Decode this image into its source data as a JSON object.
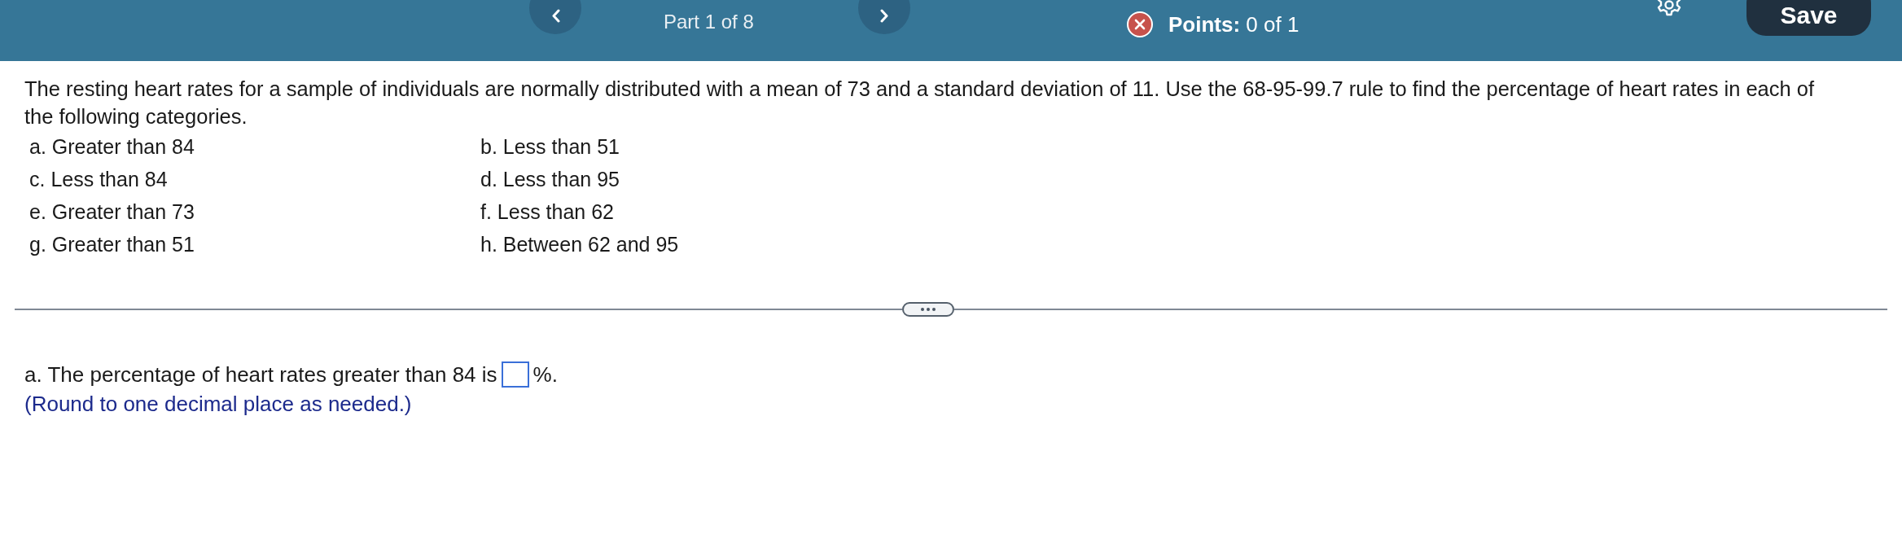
{
  "header": {
    "part": "Part 1 of 8",
    "points": {
      "correct": false,
      "text": "**Points:** 0 of 1"
    },
    "save_button": "Save"
  },
  "question": {
    "text": "The resting heart rates for a sample of individuals are normally distributed with a mean of 73 and a standard deviation of 11. Use the 68-95-99.7 rule to find the percentage of heart rates in each of the following categories.",
    "categories": [
      "a. Greater than 84",
      "b. Less than 51",
      "c. Less than 84",
      "d. Less than 95",
      "e. Greater than 73",
      "f. Less than 62",
      "g. Greater than 51",
      "h. Between 62 and 95"
    ]
  },
  "answer": {
    "prefix": "a. The percentage of heart rates greater than 84 is",
    "suffix": "%.",
    "hint": "(Round to one decimal place as needed.)"
  }
}
